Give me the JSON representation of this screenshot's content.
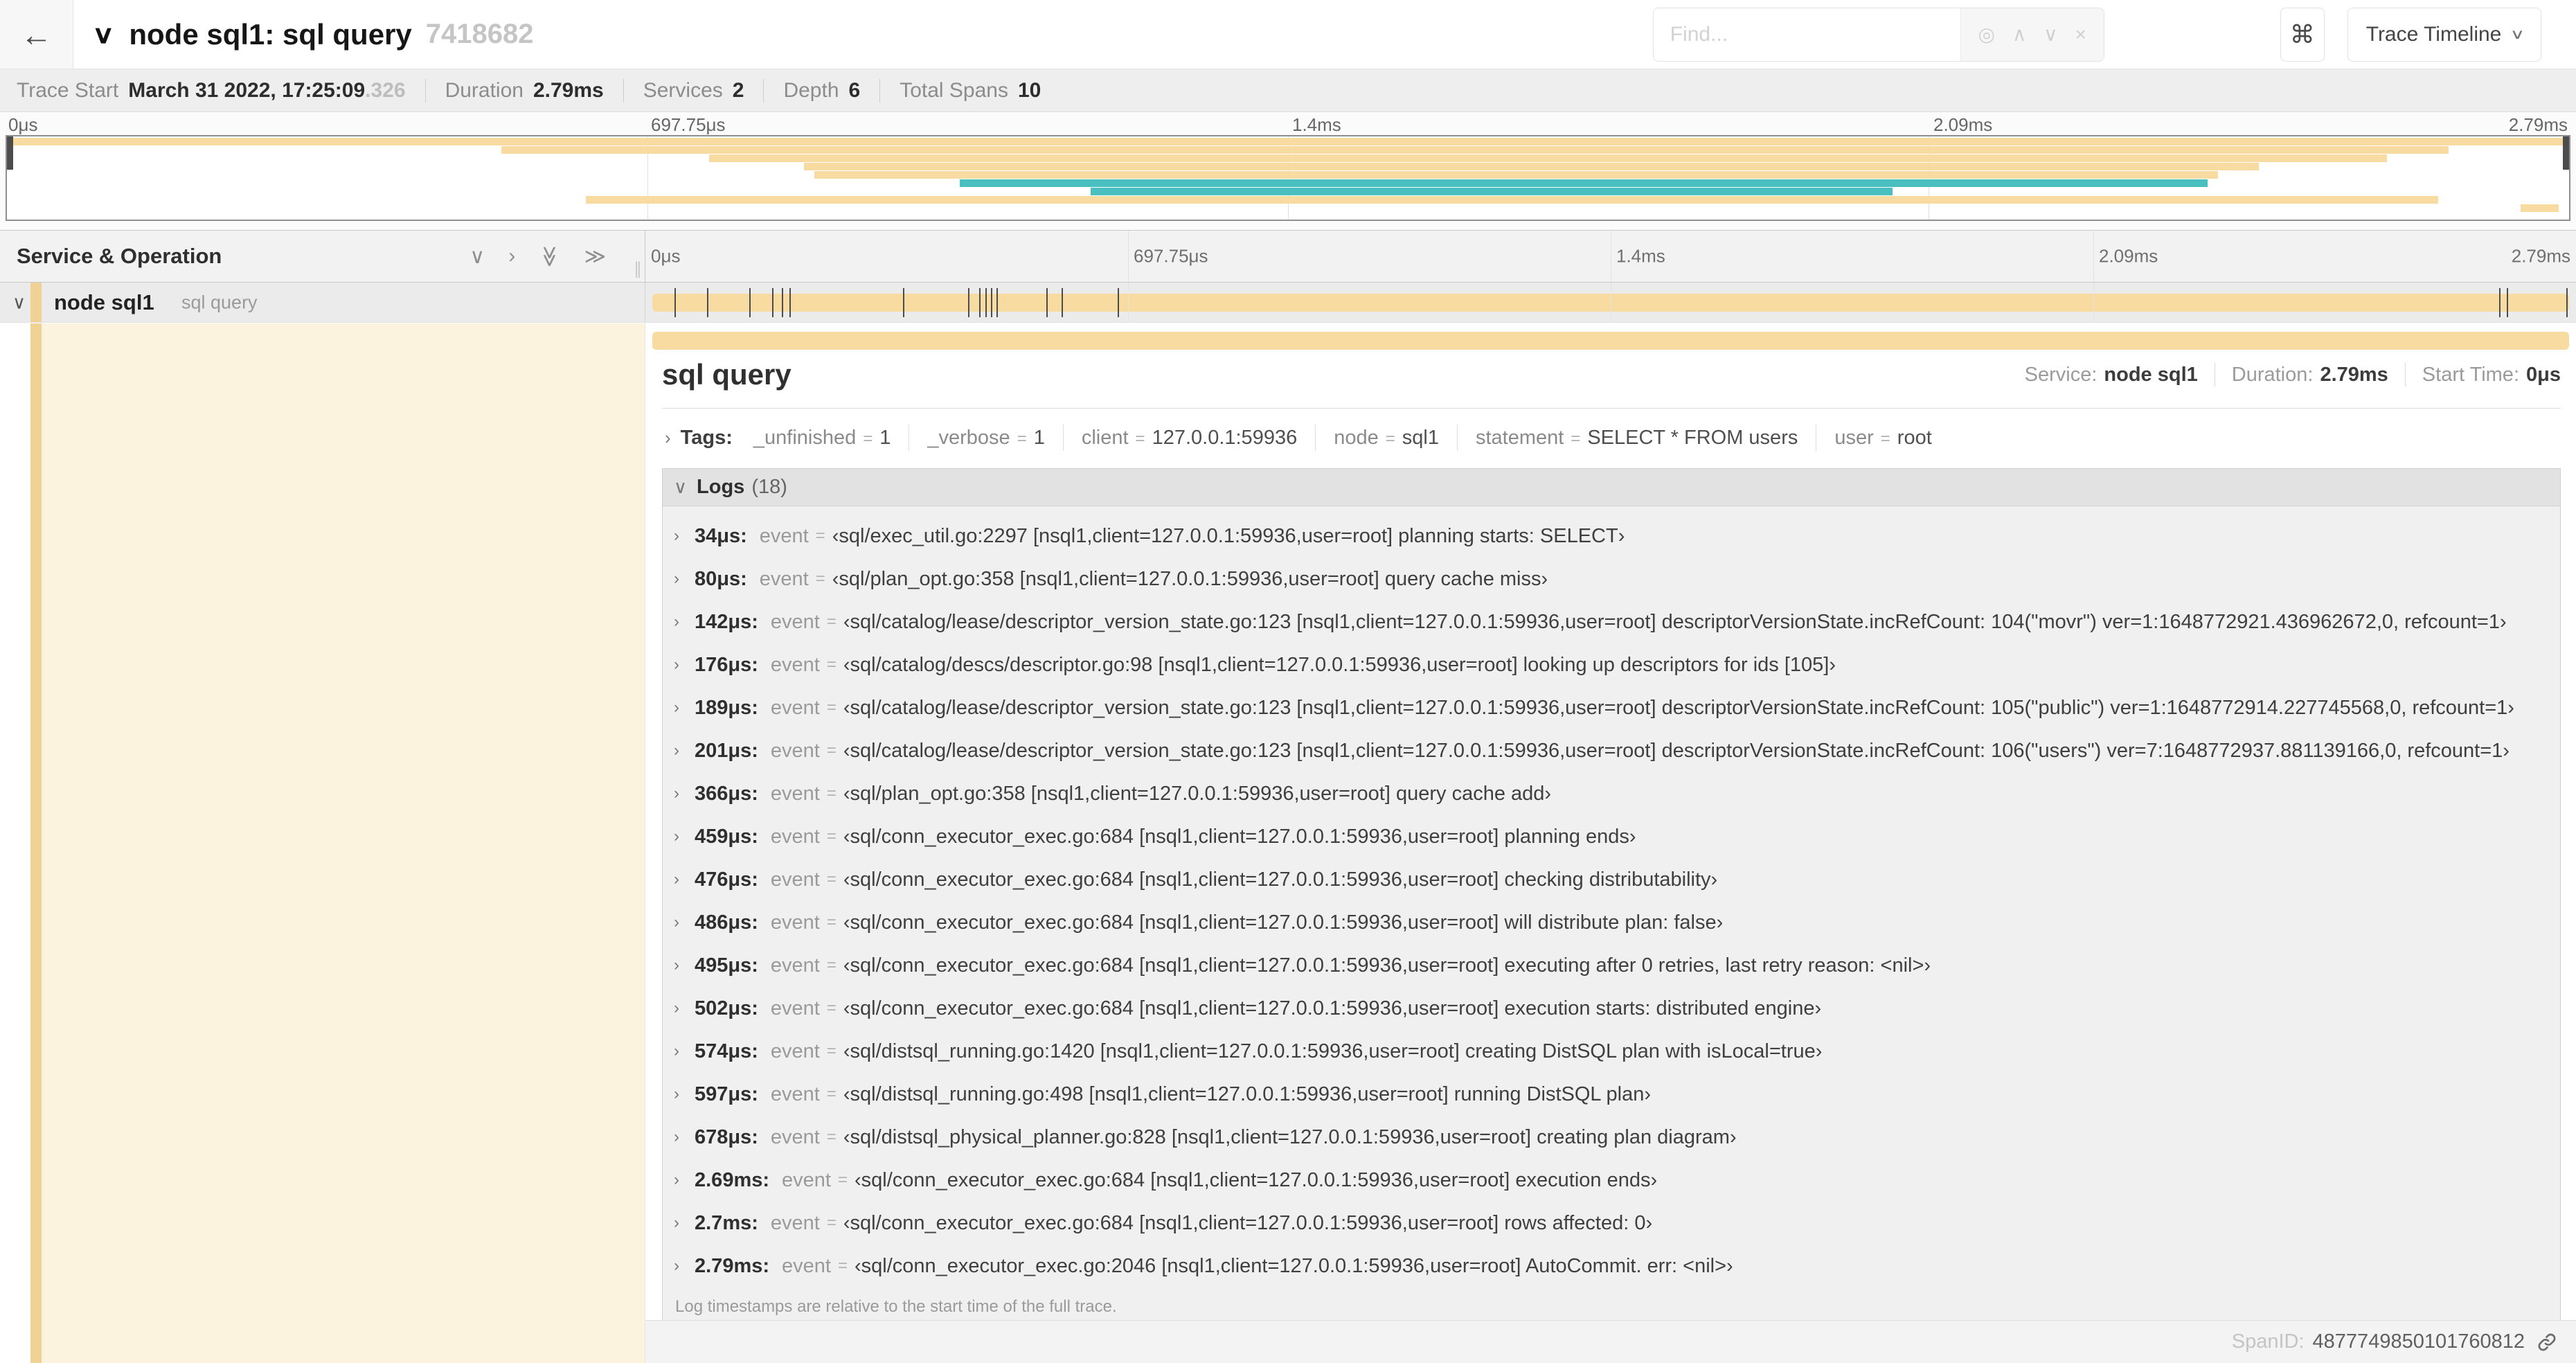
{
  "header": {
    "back_icon": "←",
    "collapse_icon": "∨",
    "title": "node sql1: sql query",
    "trace_id": "7418682",
    "find_placeholder": "Find...",
    "find_icons": [
      {
        "name": "focus-match-icon",
        "glyph": "◎"
      },
      {
        "name": "prev-result-icon",
        "glyph": "∧"
      },
      {
        "name": "next-result-icon",
        "glyph": "∨"
      },
      {
        "name": "clear-search-icon",
        "glyph": "×"
      }
    ],
    "shortcut_icon": "⌘",
    "view_selector": {
      "label": "Trace Timeline",
      "caret": "∨"
    }
  },
  "trace_info": {
    "items": [
      {
        "label": "Trace Start",
        "value": "March 31 2022, 17:25:09",
        "suffix": ".326"
      },
      {
        "label": "Duration",
        "value": "2.79ms"
      },
      {
        "label": "Services",
        "value": "2"
      },
      {
        "label": "Depth",
        "value": "6"
      },
      {
        "label": "Total Spans",
        "value": "10"
      }
    ]
  },
  "colors": {
    "span_tan": "#F7DBA0",
    "span_teal": "#49BFBF",
    "accent_stripe": "#F0D295",
    "detail_cream": "#FCF3DF"
  },
  "minimap": {
    "ticks": [
      {
        "label": "0μs",
        "pct": 0
      },
      {
        "label": "697.75μs",
        "pct": 25
      },
      {
        "label": "1.4ms",
        "pct": 50
      },
      {
        "label": "2.09ms",
        "pct": 75
      },
      {
        "label": "2.79ms",
        "pct": 100
      }
    ],
    "spans": [
      {
        "start_pct": 0,
        "end_pct": 100,
        "color": "tan"
      },
      {
        "start_pct": 19.3,
        "end_pct": 95.3,
        "color": "tan"
      },
      {
        "start_pct": 27.4,
        "end_pct": 92.9,
        "color": "tan"
      },
      {
        "start_pct": 31.1,
        "end_pct": 87.9,
        "color": "tan"
      },
      {
        "start_pct": 31.5,
        "end_pct": 86.3,
        "color": "tan"
      },
      {
        "start_pct": 37.2,
        "end_pct": 85.9,
        "color": "teal"
      },
      {
        "start_pct": 42.3,
        "end_pct": 73.6,
        "color": "teal"
      },
      {
        "start_pct": 22.6,
        "end_pct": 94.9,
        "color": "tan"
      },
      {
        "start_pct": 98.1,
        "end_pct": 99.6,
        "color": "tan"
      }
    ]
  },
  "timeline": {
    "left_header": "Service & Operation",
    "header_icons": [
      {
        "name": "collapse-one-icon",
        "glyph": "∨",
        "rotate": false
      },
      {
        "name": "expand-one-icon",
        "glyph": "›",
        "rotate": false
      },
      {
        "name": "collapse-all-icon",
        "glyph": "≫",
        "rotate": true
      },
      {
        "name": "expand-all-icon",
        "glyph": "≫",
        "rotate": false
      }
    ],
    "grip_icon": "∥",
    "ruler_ticks": [
      {
        "label": "0μs",
        "pct": 0
      },
      {
        "label": "697.75μs",
        "pct": 25
      },
      {
        "label": "1.4ms",
        "pct": 50
      },
      {
        "label": "2.09ms",
        "pct": 75
      },
      {
        "label": "2.79ms",
        "pct": 100
      }
    ]
  },
  "span_row": {
    "chevron": "∨",
    "service": "node sql1",
    "operation": "sql query",
    "bar_start_pct": 0,
    "bar_end_pct": 100,
    "log_tick_pcts": [
      1.2,
      2.9,
      5.1,
      6.3,
      6.8,
      7.2,
      13.1,
      16.5,
      17.1,
      17.4,
      17.7,
      18.0,
      20.6,
      21.4,
      24.3,
      96.4,
      96.8,
      99.9
    ]
  },
  "detail": {
    "title": "sql query",
    "meta": [
      {
        "label": "Service:",
        "value": "node sql1"
      },
      {
        "label": "Duration:",
        "value": "2.79ms"
      },
      {
        "label": "Start Time:",
        "value": "0μs"
      }
    ],
    "tags": {
      "chevron": "›",
      "label": "Tags:",
      "items": [
        {
          "key": "_unfinished",
          "value": "1"
        },
        {
          "key": "_verbose",
          "value": "1"
        },
        {
          "key": "client",
          "value": "127.0.0.1:59936"
        },
        {
          "key": "node",
          "value": "sql1"
        },
        {
          "key": "statement",
          "value": "SELECT * FROM users"
        },
        {
          "key": "user",
          "value": "root"
        }
      ]
    },
    "logs": {
      "chevron": "∨",
      "label": "Logs",
      "count": "(18)",
      "entry_chevron": "›",
      "field": "event",
      "eq": "=",
      "entries": [
        {
          "time": "34μs:",
          "value": "‹sql/exec_util.go:2297 [nsql1,client=127.0.0.1:59936,user=root] planning starts: SELECT›"
        },
        {
          "time": "80μs:",
          "value": "‹sql/plan_opt.go:358 [nsql1,client=127.0.0.1:59936,user=root] query cache miss›"
        },
        {
          "time": "142μs:",
          "value": "‹sql/catalog/lease/descriptor_version_state.go:123 [nsql1,client=127.0.0.1:59936,user=root] descriptorVersionState.incRefCount: 104(\"movr\") ver=1:1648772921.436962672,0, refcount=1›"
        },
        {
          "time": "176μs:",
          "value": "‹sql/catalog/descs/descriptor.go:98 [nsql1,client=127.0.0.1:59936,user=root] looking up descriptors for ids [105]›"
        },
        {
          "time": "189μs:",
          "value": "‹sql/catalog/lease/descriptor_version_state.go:123 [nsql1,client=127.0.0.1:59936,user=root] descriptorVersionState.incRefCount: 105(\"public\") ver=1:1648772914.227745568,0, refcount=1›"
        },
        {
          "time": "201μs:",
          "value": "‹sql/catalog/lease/descriptor_version_state.go:123 [nsql1,client=127.0.0.1:59936,user=root] descriptorVersionState.incRefCount: 106(\"users\") ver=7:1648772937.881139166,0, refcount=1›"
        },
        {
          "time": "366μs:",
          "value": "‹sql/plan_opt.go:358 [nsql1,client=127.0.0.1:59936,user=root] query cache add›"
        },
        {
          "time": "459μs:",
          "value": "‹sql/conn_executor_exec.go:684 [nsql1,client=127.0.0.1:59936,user=root] planning ends›"
        },
        {
          "time": "476μs:",
          "value": "‹sql/conn_executor_exec.go:684 [nsql1,client=127.0.0.1:59936,user=root] checking distributability›"
        },
        {
          "time": "486μs:",
          "value": "‹sql/conn_executor_exec.go:684 [nsql1,client=127.0.0.1:59936,user=root] will distribute plan: false›"
        },
        {
          "time": "495μs:",
          "value": "‹sql/conn_executor_exec.go:684 [nsql1,client=127.0.0.1:59936,user=root] executing after 0 retries, last retry reason: <nil>›"
        },
        {
          "time": "502μs:",
          "value": "‹sql/conn_executor_exec.go:684 [nsql1,client=127.0.0.1:59936,user=root] execution starts: distributed engine›"
        },
        {
          "time": "574μs:",
          "value": "‹sql/distsql_running.go:1420 [nsql1,client=127.0.0.1:59936,user=root] creating DistSQL plan with isLocal=true›"
        },
        {
          "time": "597μs:",
          "value": "‹sql/distsql_running.go:498 [nsql1,client=127.0.0.1:59936,user=root] running DistSQL plan›"
        },
        {
          "time": "678μs:",
          "value": "‹sql/distsql_physical_planner.go:828 [nsql1,client=127.0.0.1:59936,user=root] creating plan diagram›"
        },
        {
          "time": "2.69ms:",
          "value": "‹sql/conn_executor_exec.go:684 [nsql1,client=127.0.0.1:59936,user=root] execution ends›"
        },
        {
          "time": "2.7ms:",
          "value": "‹sql/conn_executor_exec.go:684 [nsql1,client=127.0.0.1:59936,user=root] rows affected: 0›"
        },
        {
          "time": "2.79ms:",
          "value": "‹sql/conn_executor_exec.go:2046 [nsql1,client=127.0.0.1:59936,user=root] AutoCommit. err: <nil>›"
        }
      ],
      "footnote": "Log timestamps are relative to the start time of the full trace."
    },
    "span_id": {
      "label": "SpanID:",
      "value": "4877749850101760812"
    }
  }
}
